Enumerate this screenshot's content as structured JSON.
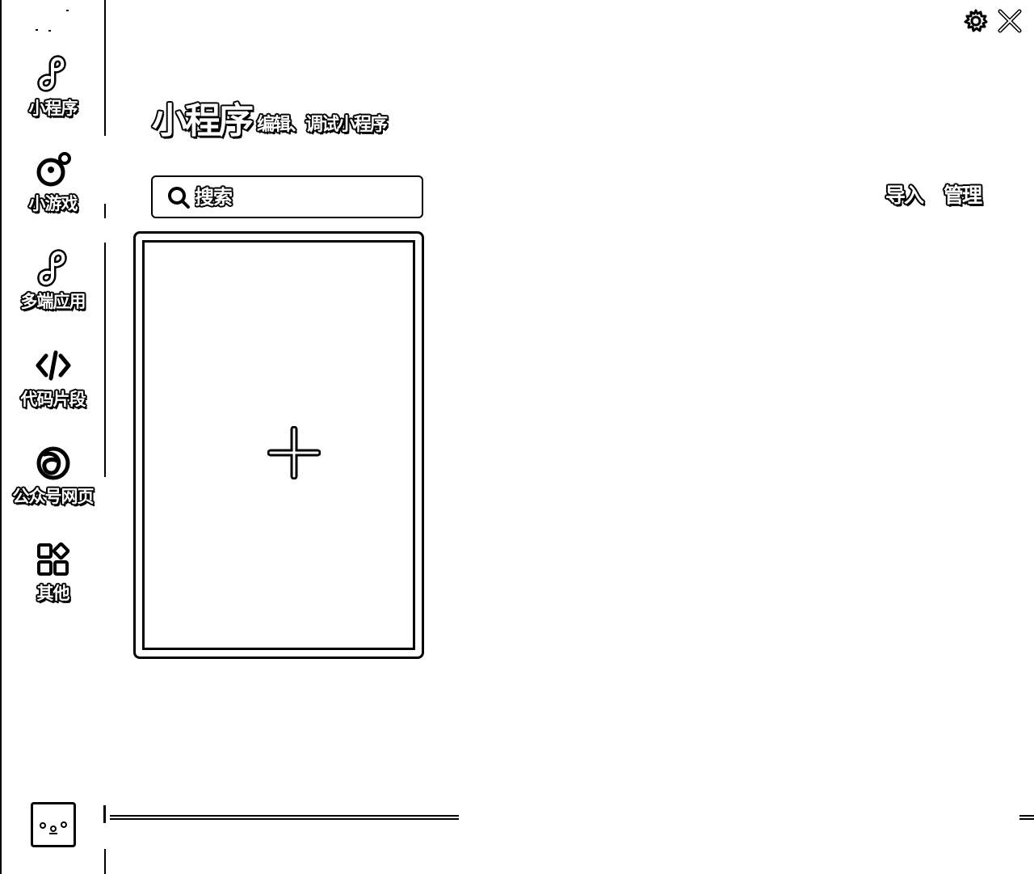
{
  "sidebar": {
    "items": [
      {
        "label": "小程序",
        "icon": "mini-program-icon"
      },
      {
        "label": "小游戏",
        "icon": "mini-game-icon"
      },
      {
        "label": "多端应用",
        "icon": "multi-platform-icon"
      },
      {
        "label": "代码片段",
        "icon": "code-snippet-icon"
      },
      {
        "label": "公众号网页",
        "icon": "official-account-web-icon"
      },
      {
        "label": "其他",
        "icon": "apps-icon"
      }
    ],
    "avatar_icon": "avatar-icon"
  },
  "window": {
    "settings_icon": "gear-icon",
    "close_icon": "close-icon"
  },
  "header": {
    "title": "小程序",
    "subtitle": "编辑、调试小程序"
  },
  "toolbar": {
    "search_placeholder": "搜索",
    "import_label": "导入",
    "manage_label": "管理"
  },
  "projects": {
    "new_project_icon": "plus-icon"
  },
  "colors": {
    "foreground": "#000000",
    "background": "#ffffff"
  }
}
